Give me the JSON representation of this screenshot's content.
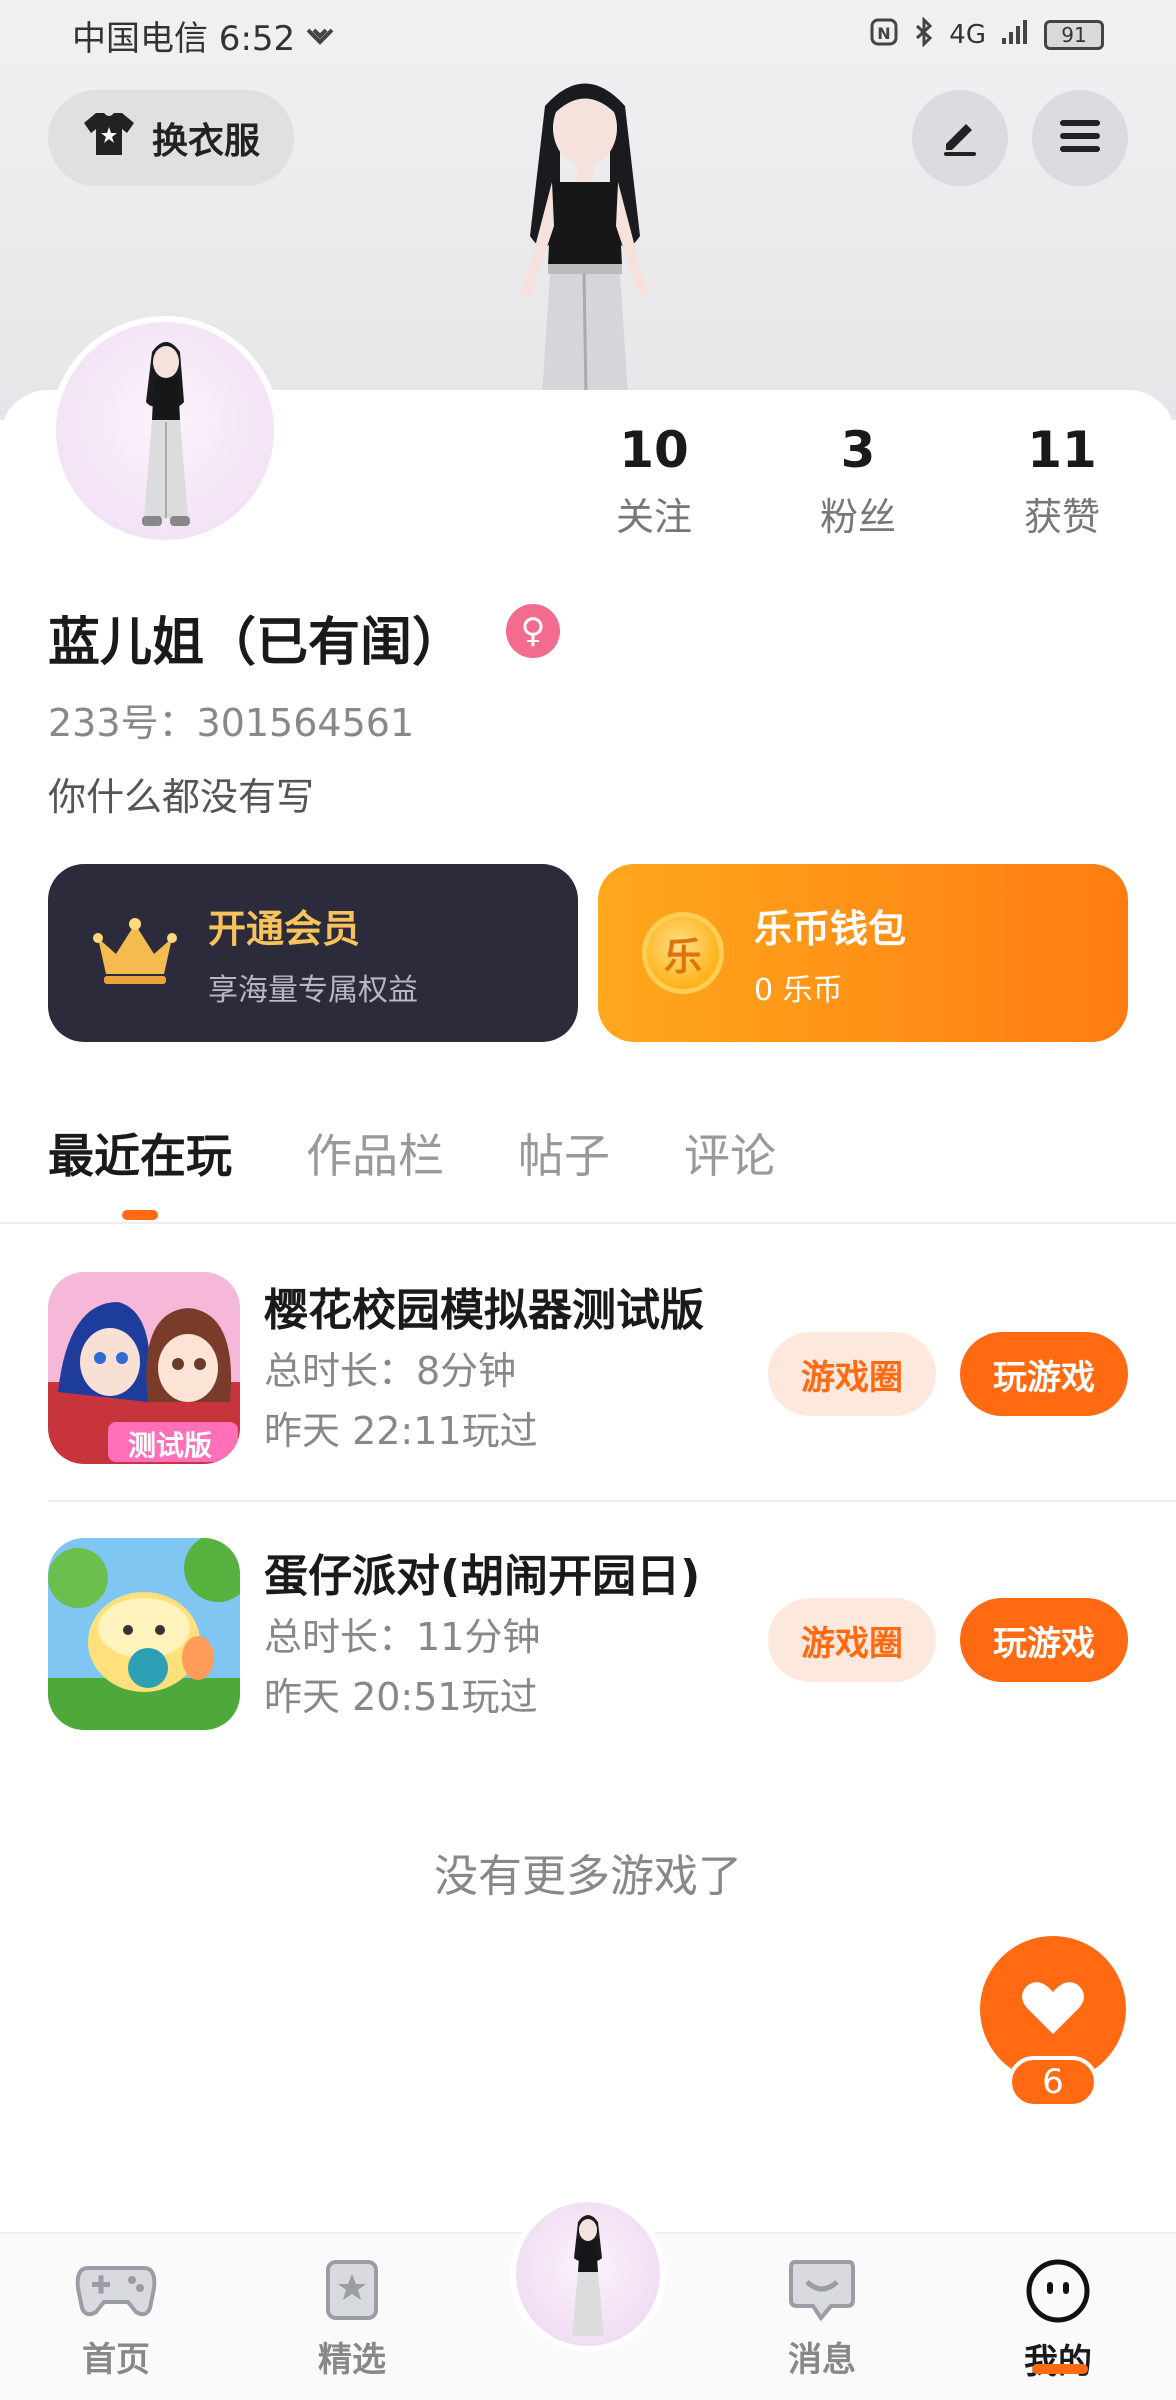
{
  "status_bar": {
    "carrier_time": "中国电信 6:52",
    "battery": "91",
    "signal": "4G"
  },
  "header": {
    "outfit_label": "换衣服"
  },
  "profile": {
    "stats": [
      {
        "value": "10",
        "label": "关注"
      },
      {
        "value": "3",
        "label": "粉丝"
      },
      {
        "value": "11",
        "label": "获赞"
      }
    ],
    "username": "蓝儿姐（已有闺）",
    "gender_symbol": "♀",
    "uid": "233号：301564561",
    "bio": "你什么都没有写"
  },
  "promo": {
    "vip_title": "开通会员",
    "vip_sub": "享海量专属权益",
    "wallet_title": "乐币钱包",
    "wallet_sub": "0 乐币",
    "coin_glyph": "乐"
  },
  "tabs": [
    "最近在玩",
    "作品栏",
    "帖子",
    "评论"
  ],
  "games": [
    {
      "name": "樱花校园模拟器测试版",
      "duration": "总时长：8分钟",
      "last_played": "昨天 22:11玩过",
      "badge": "测试版",
      "circle_btn": "游戏圈",
      "play_btn": "玩游戏"
    },
    {
      "name": "蛋仔派对(胡闹开园日)",
      "duration": "总时长：11分钟",
      "last_played": "昨天 20:51玩过",
      "circle_btn": "游戏圈",
      "play_btn": "玩游戏"
    }
  ],
  "list_end": "没有更多游戏了",
  "like_count": "6",
  "bottom_nav": [
    "首页",
    "精选",
    "消息",
    "我的"
  ],
  "colors": {
    "accent": "#ff6a13",
    "vip_bg": "#2c2b3c",
    "gold": "#f7c35a"
  }
}
